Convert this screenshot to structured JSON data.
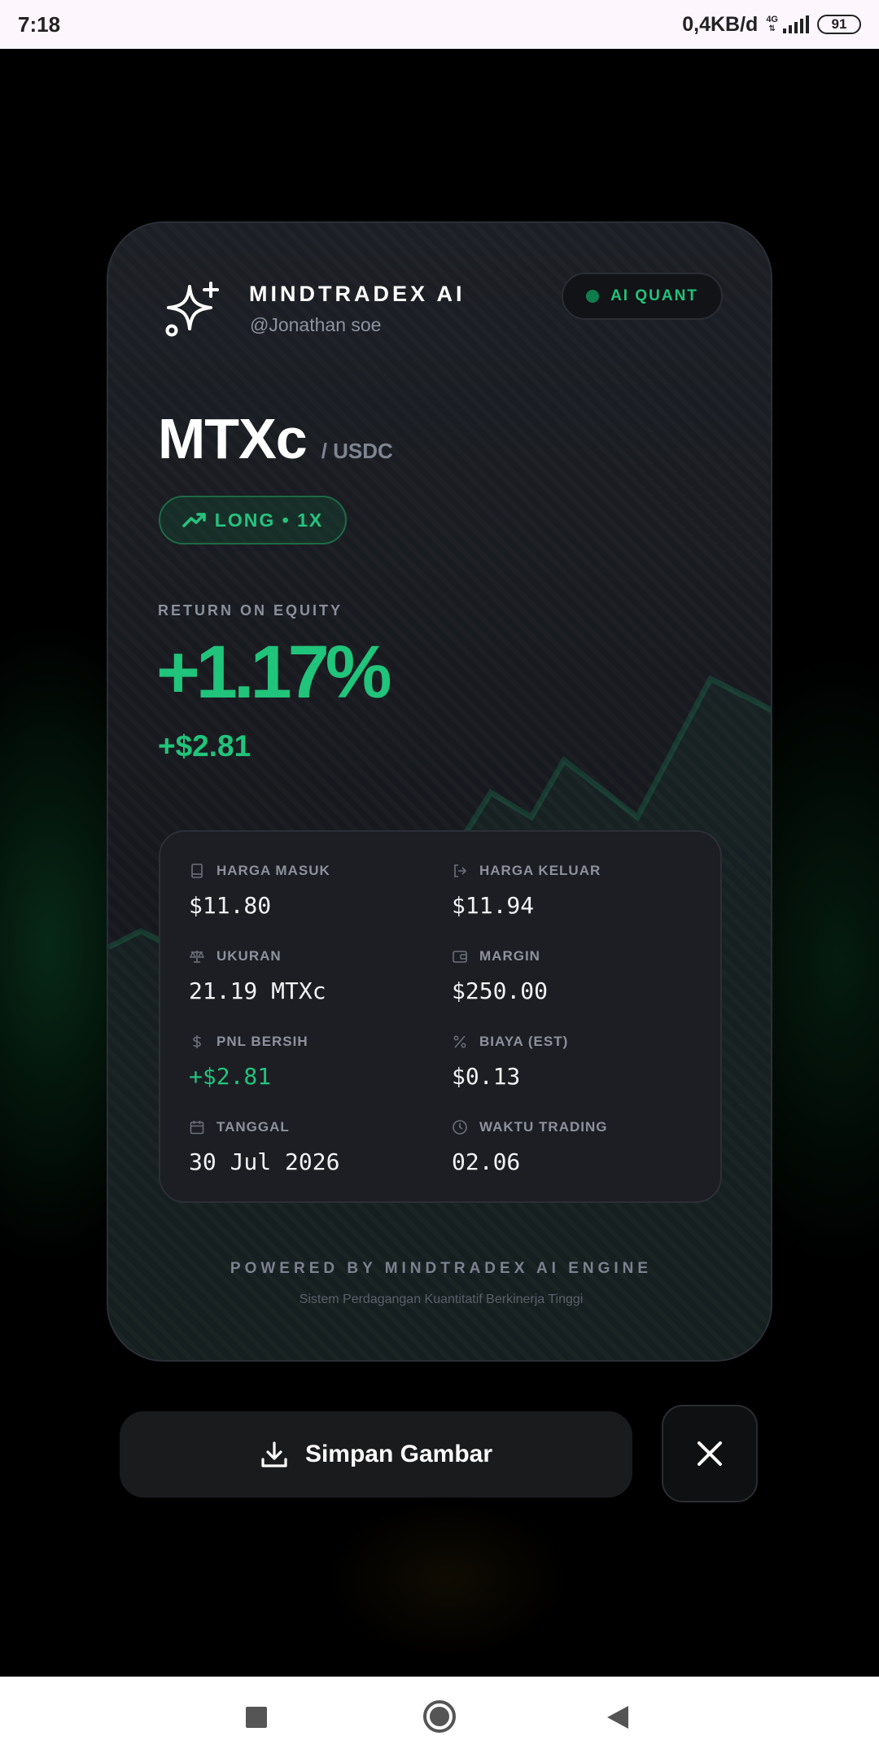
{
  "status_bar": {
    "time": "7:18",
    "network_speed": "0,4KB/d",
    "network_type": "4G",
    "battery": "91"
  },
  "card": {
    "brand": {
      "name": "MINDTRADEX AI",
      "handle": "@Jonathan soe",
      "badge": "AI QUANT"
    },
    "pair": {
      "base": "MTXc",
      "quote": "/ USDC"
    },
    "position": "LONG • 1X",
    "roe": {
      "label": "RETURN ON EQUITY",
      "value": "+1.17%",
      "pnl": "+$2.81"
    },
    "stats": [
      {
        "icon": "book-icon",
        "label": "HARGA MASUK",
        "value": "$11.80"
      },
      {
        "icon": "exit-icon",
        "label": "HARGA KELUAR",
        "value": "$11.94"
      },
      {
        "icon": "scale-icon",
        "label": "UKURAN",
        "value": "21.19 MTXc"
      },
      {
        "icon": "wallet-icon",
        "label": "MARGIN",
        "value": "$250.00"
      },
      {
        "icon": "dollar-icon",
        "label": "PNL BERSIH",
        "value": "+$2.81"
      },
      {
        "icon": "percent-icon",
        "label": "BIAYA (EST)",
        "value": "$0.13"
      },
      {
        "icon": "calendar-icon",
        "label": "TANGGAL",
        "value": "30 Jul 2026"
      },
      {
        "icon": "clock-icon",
        "label": "WAKTU TRADING",
        "value": "02.06"
      }
    ],
    "footer": {
      "title": "POWERED BY MINDTRADEX AI ENGINE",
      "subtitle": "Sistem Perdagangan Kuantitatif Berkinerja Tinggi"
    }
  },
  "actions": {
    "save_label": "Simpan Gambar",
    "save_icon": "download-icon",
    "close_icon": "close-icon"
  },
  "colors": {
    "accent_green": "#20c47a",
    "card_bg": "#16181d",
    "stats_bg": "#1c1e24"
  }
}
